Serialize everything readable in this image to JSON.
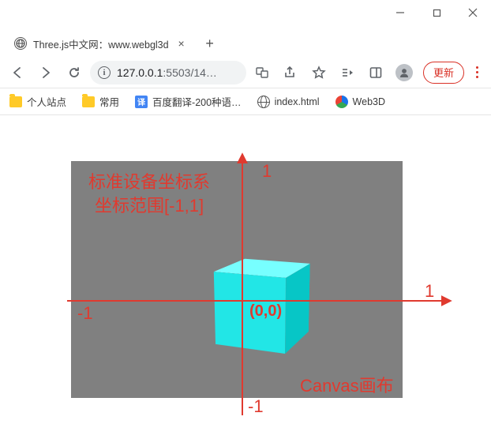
{
  "window": {
    "min_tooltip": "Minimize",
    "max_tooltip": "Maximize",
    "close_tooltip": "Close"
  },
  "tab": {
    "title": "Three.js中文网：www.webgl3d",
    "close_label": "×",
    "newtab_label": "+"
  },
  "toolbar": {
    "url_host": "127.0.0.1",
    "url_port": ":5503",
    "url_path": "/14…",
    "update_label": "更新"
  },
  "bookmarks": [
    {
      "kind": "folder",
      "label": "个人站点"
    },
    {
      "kind": "folder",
      "label": "常用"
    },
    {
      "kind": "trans",
      "label": "百度翻译-200种语…"
    },
    {
      "kind": "globe",
      "label": "index.html"
    },
    {
      "kind": "web3d",
      "label": "Web3D"
    }
  ],
  "diagram": {
    "title_line1": "标准设备坐标系",
    "title_line2": "坐标范围[-1,1]",
    "origin_label": "(0,0)",
    "x_pos": "1",
    "x_neg": "-1",
    "y_pos": "1",
    "y_neg": "-1",
    "canvas_label": "Canvas画布"
  }
}
